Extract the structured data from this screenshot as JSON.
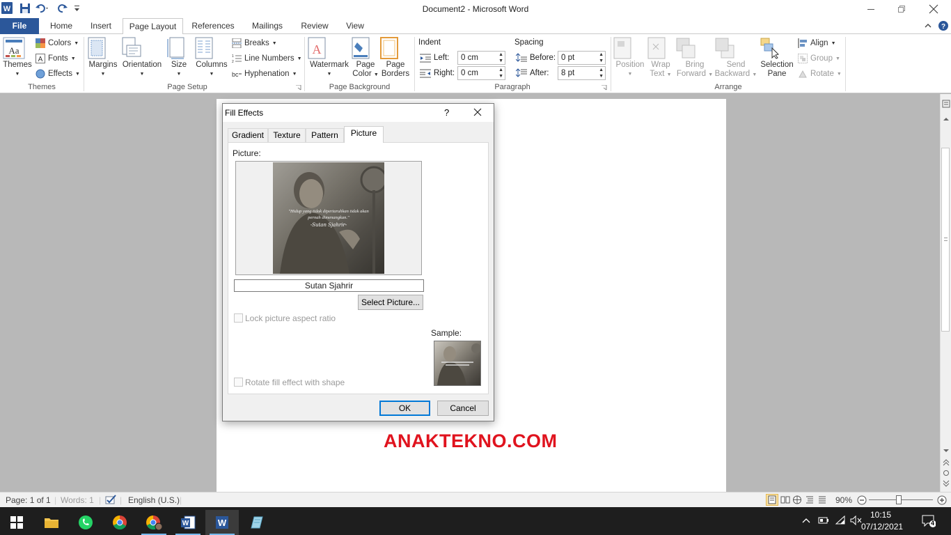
{
  "window": {
    "title": "Document2  -  Microsoft Word"
  },
  "tabs": [
    "File",
    "Home",
    "Insert",
    "Page Layout",
    "References",
    "Mailings",
    "Review",
    "View"
  ],
  "ribbon": {
    "themes": {
      "big": "Themes",
      "colors": "Colors",
      "fonts": "Fonts",
      "effects": "Effects",
      "group": "Themes"
    },
    "page_setup": {
      "margins": "Margins",
      "orientation": "Orientation",
      "size": "Size",
      "columns": "Columns",
      "breaks": "Breaks",
      "line_numbers": "Line Numbers",
      "hyphenation": "Hyphenation",
      "group": "Page Setup"
    },
    "page_background": {
      "watermark": "Watermark",
      "page_color_1": "Page",
      "page_color_2": "Color",
      "page_borders_1": "Page",
      "page_borders_2": "Borders",
      "group": "Page Background"
    },
    "paragraph": {
      "indent_label": "Indent",
      "left_label": "Left:",
      "left_value": "0 cm",
      "right_label": "Right:",
      "right_value": "0 cm",
      "spacing_label": "Spacing",
      "before_label": "Before:",
      "before_value": "0 pt",
      "after_label": "After:",
      "after_value": "8 pt",
      "group": "Paragraph"
    },
    "arrange": {
      "position": "Position",
      "wrap_1": "Wrap",
      "wrap_2": "Text",
      "bring_1": "Bring",
      "bring_2": "Forward",
      "send_1": "Send",
      "send_2": "Backward",
      "selection_1": "Selection",
      "selection_2": "Pane",
      "align": "Align",
      "group_btn": "Group",
      "rotate": "Rotate",
      "group": "Arrange"
    }
  },
  "document": {
    "watermark_text": "ANAKTEKNO.COM"
  },
  "dialog": {
    "title": "Fill Effects",
    "help": "?",
    "tabs": [
      "Gradient",
      "Texture",
      "Pattern",
      "Picture"
    ],
    "picture_label": "Picture:",
    "quote_line1": "\"Hidup yang tidak dipertaruhkan tidak akan",
    "quote_line2": "pernah dimenangkan.\"",
    "signature": "-Sutan Sjahrir-",
    "picture_name": "Sutan Sjahrir",
    "select_button": "Select Picture...",
    "lock_aspect": "Lock picture aspect ratio",
    "sample_label": "Sample:",
    "rotate_fill": "Rotate fill effect with shape",
    "ok": "OK",
    "cancel": "Cancel"
  },
  "statusbar": {
    "page": "Page: 1 of 1",
    "words": "Words: 1",
    "language": "English (U.S.)",
    "zoom": "90%"
  },
  "taskbar": {
    "time": "10:15",
    "date": "07/12/2021",
    "notifications": "4"
  },
  "colors": {
    "word_blue": "#2b579a",
    "watermark_red": "#e0131e",
    "focus_blue": "#0078d7"
  }
}
